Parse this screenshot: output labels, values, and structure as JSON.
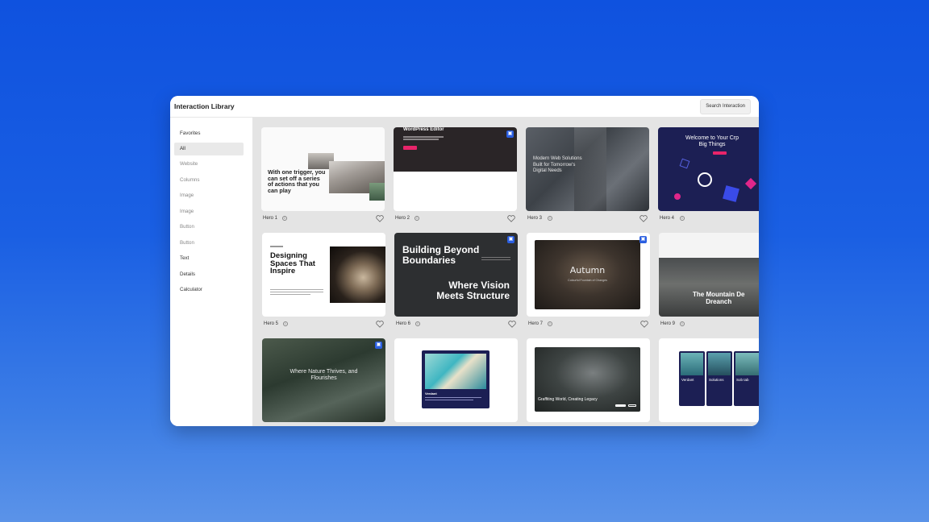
{
  "window": {
    "title": "Interaction Library",
    "search_label": "Search Interaction"
  },
  "sidebar": {
    "items": [
      {
        "label": "Favorites"
      },
      {
        "label": "All"
      },
      {
        "label": "Website"
      },
      {
        "label": "Columns"
      },
      {
        "label": "Image"
      },
      {
        "label": "Image"
      },
      {
        "label": "Button"
      },
      {
        "label": "Button"
      },
      {
        "label": "Text"
      },
      {
        "label": "Details"
      },
      {
        "label": "Calculator"
      }
    ]
  },
  "cards": [
    {
      "label": "Hero 1",
      "text": [
        "With one trigger, you",
        "can set off a series",
        "of actions that you",
        "can play"
      ]
    },
    {
      "label": "Hero 2",
      "text": [
        "WordPress Editor"
      ]
    },
    {
      "label": "Hero 3",
      "text": [
        "Modern Web Solutions",
        "Built for Tomorrow's",
        "Digital Needs"
      ]
    },
    {
      "label": "Hero 4",
      "text": [
        "Welcome to Your Crp",
        "Big Things"
      ]
    },
    {
      "label": "Hero 5",
      "text": [
        "Designing",
        "Spaces That",
        "Inspire"
      ]
    },
    {
      "label": "Hero 6",
      "text": [
        "Building Beyond",
        "Boundaries",
        "Where Vision",
        "Meets Structure"
      ]
    },
    {
      "label": "Hero 7",
      "text": [
        "Autumn",
        "Colourful Fountain of Changes"
      ]
    },
    {
      "label": "Hero 9",
      "text": [
        "The Mountain De",
        "Dreanch"
      ]
    },
    {
      "label": "",
      "text": [
        "Where Nature Thrives, and",
        "Flourishes"
      ]
    },
    {
      "label": "",
      "text": [
        "Verdant"
      ]
    },
    {
      "label": "",
      "text": [
        "Graffiting World, Creating Legacy"
      ]
    },
    {
      "label": "",
      "text": [
        "Verdant",
        "Solutions",
        "Sob tab"
      ]
    }
  ],
  "colors": {
    "accent": "#2b5fe0",
    "pink": "#e8246a",
    "navy": "#1c1f54"
  }
}
